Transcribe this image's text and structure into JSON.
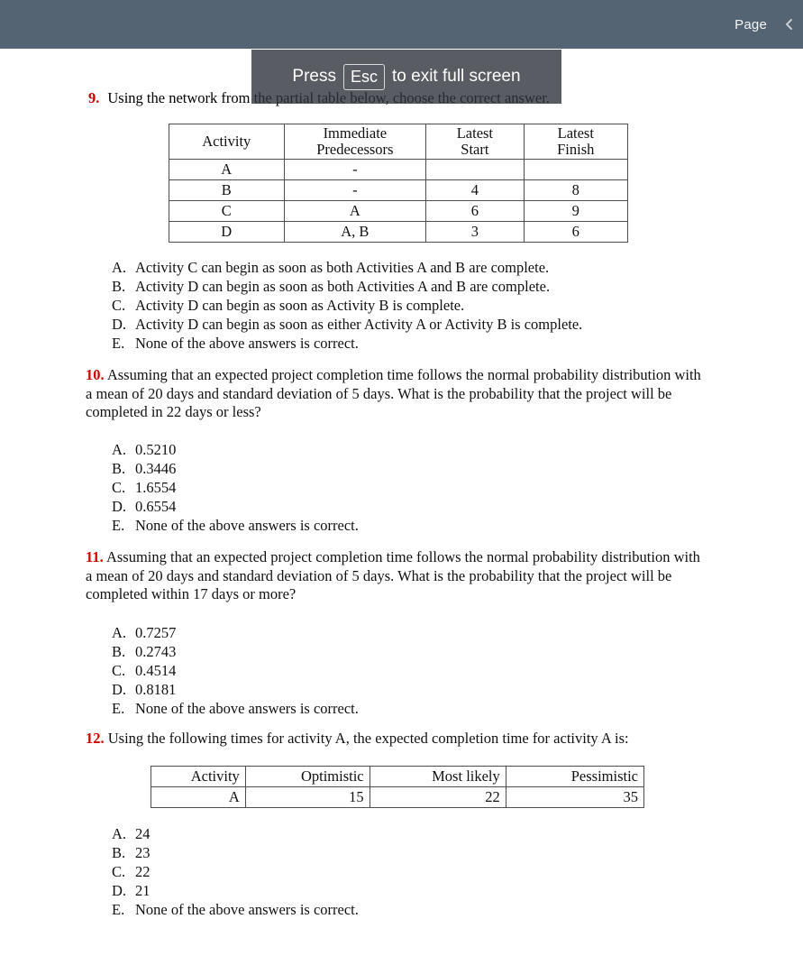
{
  "topbar": {
    "page_label": "Page",
    "nav_icon": "chevron-left-icon",
    "background_color": "#546472"
  },
  "fullscreen_toast": {
    "prefix": "Press",
    "key": "Esc",
    "suffix": "to exit full screen"
  },
  "questions": [
    {
      "number": "9.",
      "prompt": "Using the network from the partial table below, choose the correct answer.",
      "options": [
        {
          "letter": "A.",
          "text": "Activity C can begin as soon as both Activities A and B are complete."
        },
        {
          "letter": "B.",
          "text": "Activity D can begin as soon as both Activities A and B are complete."
        },
        {
          "letter": "C.",
          "text": "Activity D can begin as soon as Activity B is complete."
        },
        {
          "letter": "D.",
          "text": "Activity D can begin as soon as either Activity A or Activity B is complete."
        },
        {
          "letter": "E.",
          "text": "None of the above answers is correct."
        }
      ]
    },
    {
      "number": "10.",
      "prompt": "Assuming that an expected project completion time follows the normal probability distribution with a mean of 20 days and standard deviation of 5 days. What is the probability that the project will be completed in 22 days or less?",
      "options": [
        {
          "letter": "A.",
          "text": "0.5210"
        },
        {
          "letter": "B.",
          "text": "0.3446"
        },
        {
          "letter": "C.",
          "text": "1.6554"
        },
        {
          "letter": "D.",
          "text": "0.6554"
        },
        {
          "letter": "E.",
          "text": "None of the above answers is correct."
        }
      ]
    },
    {
      "number": "11.",
      "prompt": "Assuming that an expected project completion time follows the normal probability distribution with a mean of 20 days and standard deviation of 5 days. What is the probability that the project will be completed within 17 days or more?",
      "options": [
        {
          "letter": "A.",
          "text": "0.7257"
        },
        {
          "letter": "B.",
          "text": "0.2743"
        },
        {
          "letter": "C.",
          "text": "0.4514"
        },
        {
          "letter": "D.",
          "text": "0.8181"
        },
        {
          "letter": "E.",
          "text": "None of the above answers is correct."
        }
      ]
    },
    {
      "number": "12.",
      "prompt": "Using the following times for activity A, the expected completion time for activity A is:",
      "options": [
        {
          "letter": "A.",
          "text": "24"
        },
        {
          "letter": "B.",
          "text": "23"
        },
        {
          "letter": "C.",
          "text": "22"
        },
        {
          "letter": "D.",
          "text": "21"
        },
        {
          "letter": "E.",
          "text": "None of the above answers is correct."
        }
      ]
    }
  ],
  "activity_table": {
    "headers": [
      "Activity",
      "Immediate Predecessors",
      "Latest Start",
      "Latest Finish"
    ],
    "headers_split": [
      {
        "l1": "Activity",
        "l2": ""
      },
      {
        "l1": "Immediate",
        "l2": "Predecessors"
      },
      {
        "l1": "Latest",
        "l2": "Start"
      },
      {
        "l1": "Latest",
        "l2": "Finish"
      }
    ],
    "rows": [
      {
        "activity": "A",
        "predecessors": "-",
        "latest_start": "",
        "latest_finish": ""
      },
      {
        "activity": "B",
        "predecessors": "-",
        "latest_start": "4",
        "latest_finish": "8"
      },
      {
        "activity": "C",
        "predecessors": "A",
        "latest_start": "6",
        "latest_finish": "9"
      },
      {
        "activity": "D",
        "predecessors": "A,  B",
        "latest_start": "3",
        "latest_finish": "6"
      }
    ]
  },
  "pert_table": {
    "headers": [
      "Activity",
      "Optimistic",
      "Most likely",
      "Pessimistic"
    ],
    "rows": [
      {
        "activity": "A",
        "optimistic": "15",
        "most_likely": "22",
        "pessimistic": "35"
      }
    ]
  }
}
